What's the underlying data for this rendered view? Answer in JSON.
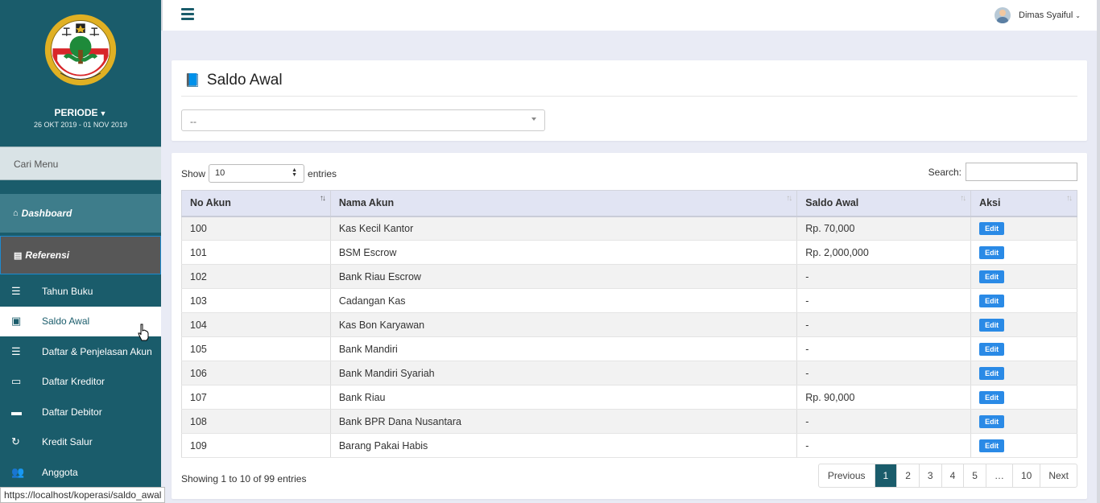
{
  "sidebar": {
    "periode_label": "PERIODE",
    "periode_date": "26 OKT 2019 - 01 NOV 2019",
    "search_placeholder": "Cari Menu",
    "dashboard": "Dashboard",
    "referensi": "Referensi",
    "items": [
      {
        "label": "Tahun Buku",
        "icon": "list-icon"
      },
      {
        "label": "Saldo Awal",
        "icon": "money-icon"
      },
      {
        "label": "Daftar & Penjelasan Akun",
        "icon": "list-icon"
      },
      {
        "label": "Daftar Kreditor",
        "icon": "credit-card-icon"
      },
      {
        "label": "Daftar Debitor",
        "icon": "credit-card-icon"
      },
      {
        "label": "Kredit Salur",
        "icon": "refresh-icon"
      },
      {
        "label": "Anggota",
        "icon": "users-icon"
      }
    ]
  },
  "status_url": "https://localhost/koperasi/saldo_awal",
  "topbar": {
    "user_name": "Dimas Syaiful"
  },
  "page": {
    "title": "Saldo Awal",
    "select_value": "--"
  },
  "table_controls": {
    "show_label": "Show",
    "entries_label": "entries",
    "length_value": "10",
    "search_label": "Search:"
  },
  "table": {
    "headers": [
      "No Akun",
      "Nama Akun",
      "Saldo Awal",
      "Aksi"
    ],
    "edit_label": "Edit",
    "rows": [
      {
        "no": "100",
        "nama": "Kas Kecil Kantor",
        "saldo": "Rp. 70,000"
      },
      {
        "no": "101",
        "nama": "BSM Escrow",
        "saldo": "Rp. 2,000,000"
      },
      {
        "no": "102",
        "nama": "Bank Riau Escrow",
        "saldo": "-"
      },
      {
        "no": "103",
        "nama": "Cadangan Kas",
        "saldo": "-"
      },
      {
        "no": "104",
        "nama": "Kas Bon Karyawan",
        "saldo": "-"
      },
      {
        "no": "105",
        "nama": "Bank Mandiri",
        "saldo": "-"
      },
      {
        "no": "106",
        "nama": "Bank Mandiri Syariah",
        "saldo": "-"
      },
      {
        "no": "107",
        "nama": "Bank Riau",
        "saldo": "Rp. 90,000"
      },
      {
        "no": "108",
        "nama": "Bank BPR Dana Nusantara",
        "saldo": "-"
      },
      {
        "no": "109",
        "nama": "Barang Pakai Habis",
        "saldo": "-"
      }
    ]
  },
  "footer": {
    "info": "Showing 1 to 10 of 99 entries",
    "pagination": [
      "Previous",
      "1",
      "2",
      "3",
      "4",
      "5",
      "…",
      "10",
      "Next"
    ],
    "current_page": "1"
  },
  "colors": {
    "sidebar": "#1a5c6b",
    "accent_button": "#2a8ae6",
    "table_header": "#e1e4f3"
  }
}
